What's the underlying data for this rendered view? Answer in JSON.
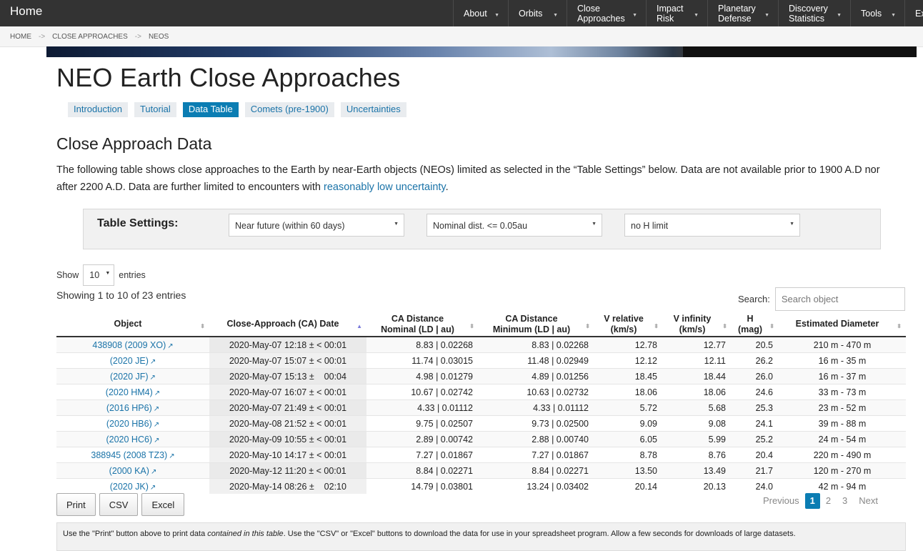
{
  "nav": {
    "brand": "Home",
    "items": [
      {
        "label": "About"
      },
      {
        "label": "Orbits"
      },
      {
        "label": "Close\nApproaches"
      },
      {
        "label": "Impact\nRisk"
      },
      {
        "label": "Planetary\nDefense"
      },
      {
        "label": "Discovery\nStatistics"
      },
      {
        "label": "Tools"
      },
      {
        "label": "Ex"
      }
    ]
  },
  "breadcrumb": [
    "HOME",
    "CLOSE APPROACHES",
    "NEOS"
  ],
  "breadcrumb_sep": "->",
  "page_title": "NEO Earth Close Approaches",
  "tabs": [
    "Introduction",
    "Tutorial",
    "Data Table",
    "Comets (pre-1900)",
    "Uncertainties"
  ],
  "active_tab": "Data Table",
  "section_title": "Close Approach Data",
  "intro": {
    "text": "The following table shows close approaches to the Earth by near-Earth objects (NEOs) limited as selected in the “Table Settings” below. Data are not available prior to 1900 A.D nor after 2200 A.D. Data are further limited to encounters with ",
    "link": "reasonably low uncertainty",
    "end": "."
  },
  "settings": {
    "label": "Table Settings:",
    "time_range": "Near future (within 60 days)",
    "distance": "Nominal dist. <= 0.05au",
    "h_limit": "no H limit"
  },
  "length": {
    "show": "Show",
    "value": "10",
    "entries": "entries"
  },
  "info": "Showing 1 to 10 of 23 entries",
  "search": {
    "label": "Search:",
    "placeholder": "Search object"
  },
  "table": {
    "headers": [
      "Object",
      "Close-Approach (CA) Date",
      "CA Distance\nNominal (LD | au)",
      "CA Distance\nMinimum (LD | au)",
      "V relative\n(km/s)",
      "V infinity\n(km/s)",
      "H\n(mag)",
      "Estimated Diameter"
    ],
    "rows": [
      [
        "438908 (2009 XO)",
        "2020-May-07 12:18 ± < 00:01",
        "8.83 | 0.02268",
        "8.83 | 0.02268",
        "12.78",
        "12.77",
        "20.5",
        "210 m - 470 m"
      ],
      [
        "(2020 JE)",
        "2020-May-07 15:07 ± < 00:01",
        "11.74 | 0.03015",
        "11.48 | 0.02949",
        "12.12",
        "12.11",
        "26.2",
        "16 m - 35 m"
      ],
      [
        "(2020 JF)",
        "2020-May-07 15:13 ±    00:04",
        "4.98 | 0.01279",
        "4.89 | 0.01256",
        "18.45",
        "18.44",
        "26.0",
        "16 m - 37 m"
      ],
      [
        "(2020 HM4)",
        "2020-May-07 16:07 ± < 00:01",
        "10.67 | 0.02742",
        "10.63 | 0.02732",
        "18.06",
        "18.06",
        "24.6",
        "33 m - 73 m"
      ],
      [
        "(2016 HP6)",
        "2020-May-07 21:49 ± < 00:01",
        "4.33 | 0.01112",
        "4.33 | 0.01112",
        "5.72",
        "5.68",
        "25.3",
        "23 m - 52 m"
      ],
      [
        "(2020 HB6)",
        "2020-May-08 21:52 ± < 00:01",
        "9.75 | 0.02507",
        "9.73 | 0.02500",
        "9.09",
        "9.08",
        "24.1",
        "39 m - 88 m"
      ],
      [
        "(2020 HC6)",
        "2020-May-09 10:55 ± < 00:01",
        "2.89 | 0.00742",
        "2.88 | 0.00740",
        "6.05",
        "5.99",
        "25.2",
        "24 m - 54 m"
      ],
      [
        "388945 (2008 TZ3)",
        "2020-May-10 14:17 ± < 00:01",
        "7.27 | 0.01867",
        "7.27 | 0.01867",
        "8.78",
        "8.76",
        "20.4",
        "220 m - 490 m"
      ],
      [
        "(2000 KA)",
        "2020-May-12 11:20 ± < 00:01",
        "8.84 | 0.02271",
        "8.84 | 0.02271",
        "13.50",
        "13.49",
        "21.7",
        "120 m - 270 m"
      ],
      [
        "(2020 JK)",
        "2020-May-14 08:26 ±    02:10",
        "14.79 | 0.03801",
        "13.24 | 0.03402",
        "20.14",
        "20.13",
        "24.0",
        "42 m - 94 m"
      ]
    ]
  },
  "buttons": {
    "print": "Print",
    "csv": "CSV",
    "excel": "Excel"
  },
  "pager": {
    "previous": "Previous",
    "pages": [
      "1",
      "2",
      "3"
    ],
    "current": "1",
    "next": "Next"
  },
  "note": {
    "a": "Use the \"Print\" button above to print data ",
    "em": "contained in this table",
    "b": ". Use the \"CSV\" or \"Excel\" buttons to download the data for use in your spreadsheet program. Allow a few seconds for downloads of large datasets."
  },
  "colors": {
    "accent": "#0b7db3",
    "link": "#1a73a8",
    "nav_bg": "#333333"
  }
}
